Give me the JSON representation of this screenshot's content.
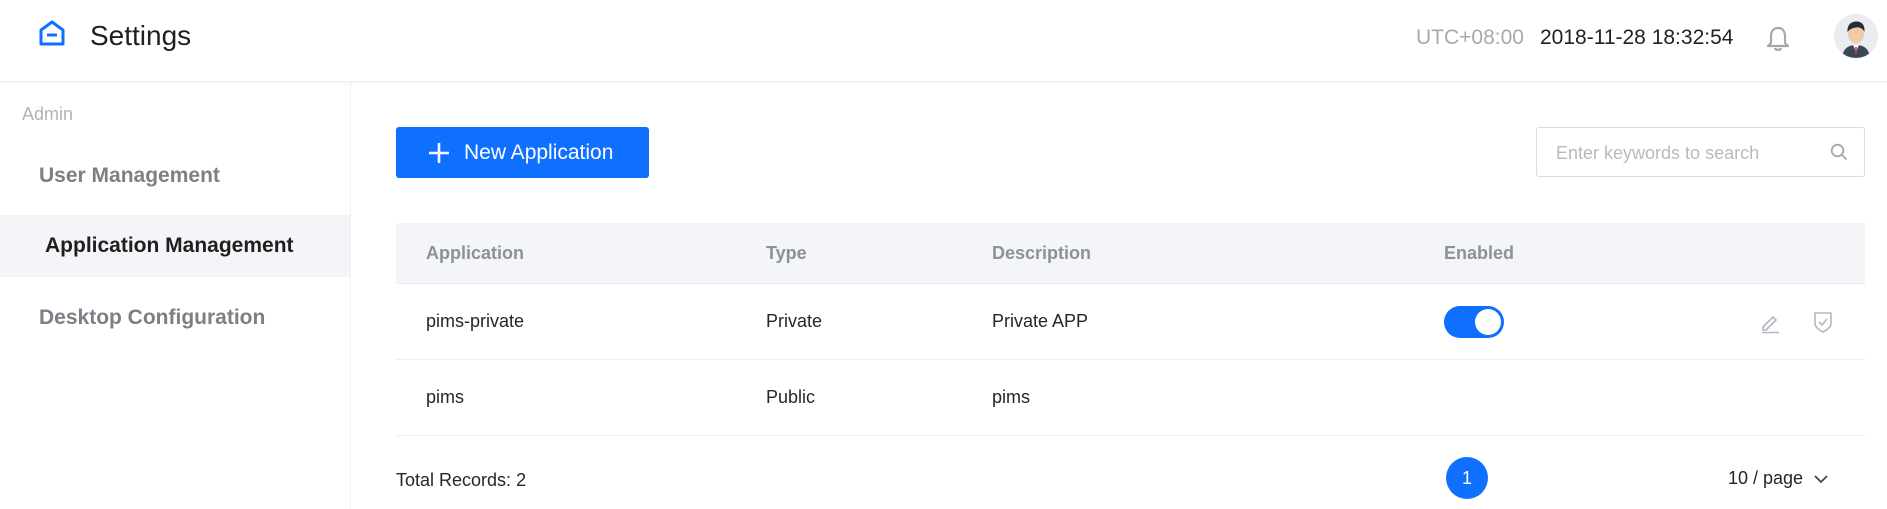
{
  "header": {
    "title": "Settings",
    "timezone": "UTC+08:00",
    "datetime": "2018-11-28 18:32:54",
    "icons": {
      "logo": "home-icon",
      "notifications": "bell-icon",
      "avatar": "user-avatar"
    }
  },
  "sidebar": {
    "section_label": "Admin",
    "items": [
      {
        "label": "User Management",
        "active": false
      },
      {
        "label": "Application Management",
        "active": true
      },
      {
        "label": "Desktop Configuration",
        "active": false
      }
    ]
  },
  "toolbar": {
    "new_button_label": "New Application",
    "search_placeholder": "Enter keywords to search",
    "search_value": ""
  },
  "table": {
    "columns": [
      "Application",
      "Type",
      "Description",
      "Enabled"
    ],
    "rows": [
      {
        "application": "pims-private",
        "type": "Private",
        "description": "Private APP",
        "enabled": true
      },
      {
        "application": "pims",
        "type": "Public",
        "description": "pims",
        "enabled": null
      }
    ]
  },
  "pagination": {
    "total_label": "Total Records:",
    "total_value": "2",
    "current_page": "1",
    "page_size_label": "10 / page"
  },
  "colors": {
    "accent": "#0f6fff",
    "sidebar_active_bg": "#f4f5f8",
    "table_header_bg": "#f4f5f8",
    "muted_text": "#a6a9b0"
  }
}
